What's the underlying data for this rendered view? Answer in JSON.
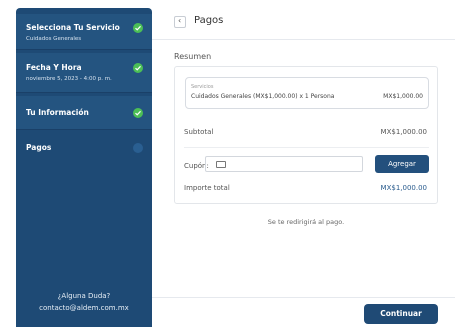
{
  "sidebar": {
    "steps": [
      {
        "title": "Selecciona Tu Servicio",
        "subtitle": "Cuidados Generales",
        "status": "completed"
      },
      {
        "title": "Fecha Y Hora",
        "subtitle": "noviembre 5, 2023 - 4:00 p. m.",
        "status": "completed"
      },
      {
        "title": "Tu Información",
        "subtitle": "",
        "status": "completed"
      },
      {
        "title": "Pagos",
        "subtitle": "",
        "status": "current"
      }
    ],
    "help_title": "¿Alguna Duda?",
    "help_email": "contacto@aldem.com.mx"
  },
  "header": {
    "title": "Pagos"
  },
  "summary": {
    "heading": "Resumen",
    "service_label": "Servicios",
    "service_name": "Cuidados Generales (MX$1,000.00) x 1 Persona",
    "service_price": "MX$1,000.00",
    "subtotal_label": "Subtotal",
    "subtotal_value": "MX$1,000.00",
    "coupon_label": "Cupón:",
    "coupon_value": "",
    "coupon_button": "Agregar",
    "total_label": "Importe total",
    "total_value": "MX$1,000.00"
  },
  "redirect_note": "Se te redirigirá al pago.",
  "footer": {
    "continue_label": "Continuar"
  },
  "colors": {
    "sidebar": "#1e4a75",
    "check": "#4cbf56",
    "primary": "#23507d"
  }
}
